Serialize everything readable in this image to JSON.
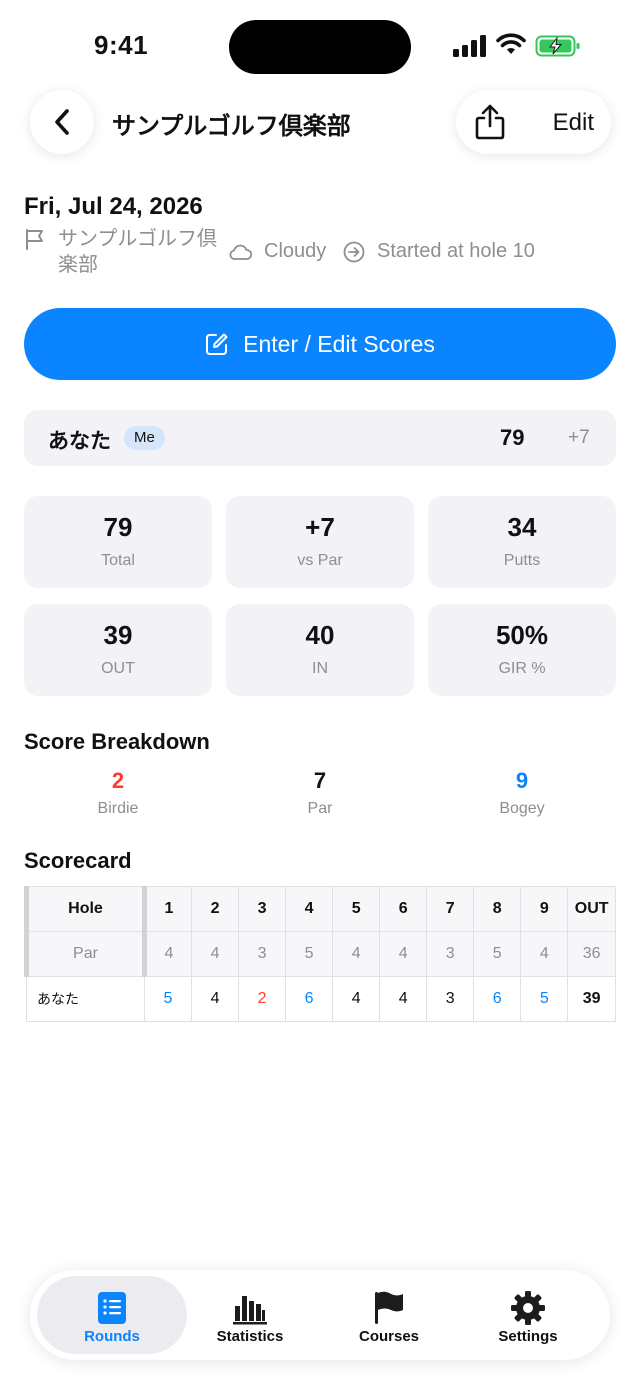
{
  "status_bar": {
    "time": "9:41"
  },
  "header": {
    "title": "サンプルゴルフ倶楽部",
    "edit_label": "Edit"
  },
  "round": {
    "date": "Fri, Jul 24, 2026",
    "course_name": "サンプルゴルフ倶楽部",
    "weather": "Cloudy",
    "start_info": "Started at hole 10"
  },
  "primary_button": {
    "label": "Enter / Edit Scores"
  },
  "player": {
    "name": "あなた",
    "badge": "Me",
    "score": "79",
    "diff": "+7"
  },
  "stats": [
    {
      "value": "79",
      "label": "Total"
    },
    {
      "value": "+7",
      "label": "vs Par"
    },
    {
      "value": "34",
      "label": "Putts"
    },
    {
      "value": "39",
      "label": "OUT"
    },
    {
      "value": "40",
      "label": "IN"
    },
    {
      "value": "50%",
      "label": "GIR %"
    }
  ],
  "breakdown": {
    "title": "Score Breakdown",
    "items": [
      {
        "count": "2",
        "label": "Birdie",
        "color": "#ff3b30"
      },
      {
        "count": "7",
        "label": "Par",
        "color": "#111111"
      },
      {
        "count": "9",
        "label": "Bogey",
        "color": "#0a84ff"
      }
    ]
  },
  "scorecard": {
    "title": "Scorecard",
    "hole_label": "Hole",
    "par_label": "Par",
    "holes": [
      "1",
      "2",
      "3",
      "4",
      "5",
      "6",
      "7",
      "8",
      "9"
    ],
    "out_label": "OUT",
    "pars": [
      "4",
      "4",
      "3",
      "5",
      "4",
      "4",
      "3",
      "5",
      "4"
    ],
    "par_out": "36",
    "player_name": "あなた",
    "scores": [
      "5",
      "4",
      "2",
      "6",
      "4",
      "4",
      "3",
      "6",
      "5"
    ],
    "score_out": "39",
    "colors": {
      "over": "#0a84ff",
      "under": "#ff3b30"
    }
  },
  "tabs": [
    {
      "label": "Rounds",
      "icon": "rounds-icon",
      "active": true
    },
    {
      "label": "Statistics",
      "icon": "statistics-icon",
      "active": false
    },
    {
      "label": "Courses",
      "icon": "flag-icon",
      "active": false
    },
    {
      "label": "Settings",
      "icon": "gear-icon",
      "active": false
    }
  ]
}
